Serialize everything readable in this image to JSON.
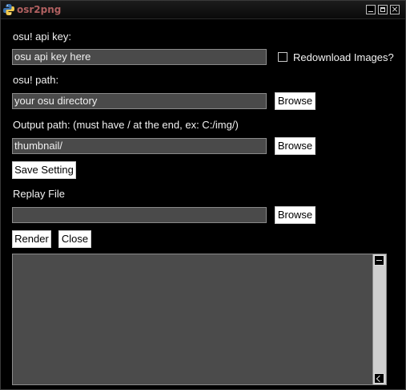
{
  "window": {
    "title": "osr2png"
  },
  "api": {
    "label": "osu! api key:",
    "value": "osu api key here",
    "redownload_label": "Redownload Images?",
    "redownload_checked": false
  },
  "osu_path": {
    "label": "osu! path:",
    "value": "your osu directory",
    "browse": "Browse"
  },
  "output_path": {
    "label": "Output path: (must have / at the end, ex: C:/img/)",
    "value": "thumbnail/",
    "browse": "Browse"
  },
  "save_setting": "Save Setting",
  "replay": {
    "label": "Replay File",
    "value": "",
    "browse": "Browse"
  },
  "actions": {
    "render": "Render",
    "close": "Close"
  },
  "log": {
    "text": ""
  }
}
